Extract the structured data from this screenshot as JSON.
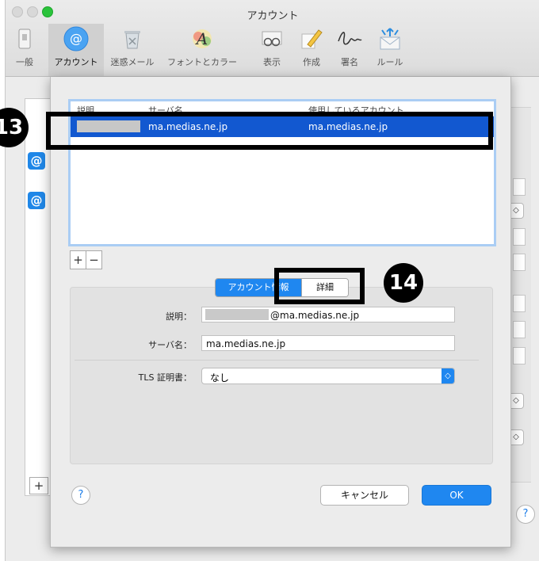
{
  "window": {
    "title": "アカウント"
  },
  "toolbar": {
    "items": [
      {
        "label": "一般"
      },
      {
        "label": "アカウント"
      },
      {
        "label": "迷惑メール"
      },
      {
        "label": "フォントとカラー"
      },
      {
        "label": "表示"
      },
      {
        "label": "作成"
      },
      {
        "label": "署名"
      },
      {
        "label": "ルール"
      }
    ]
  },
  "server_list": {
    "headers": [
      "説明",
      "サーバ名",
      "使用しているアカウント"
    ],
    "rows": [
      {
        "server": "ma.medias.ne.jp",
        "account": "ma.medias.ne.jp",
        "selected": true
      }
    ],
    "add_label": "+",
    "remove_label": "−"
  },
  "tabs": {
    "account_info": "アカウント情報",
    "details": "詳細"
  },
  "form": {
    "description_label": "説明：",
    "description_value": "@ma.medias.ne.jp",
    "server_label": "サーバ名：",
    "server_value": "ma.medias.ne.jp",
    "tls_label": "TLS 証明書：",
    "tls_value": "なし"
  },
  "buttons": {
    "help": "?",
    "cancel": "キャンセル",
    "ok": "OK"
  },
  "background": {
    "add_label": "+",
    "help": "?"
  },
  "callouts": {
    "c13": "13",
    "c14": "14"
  },
  "colors": {
    "accent": "#1f87f0",
    "selection": "#1258d0"
  }
}
